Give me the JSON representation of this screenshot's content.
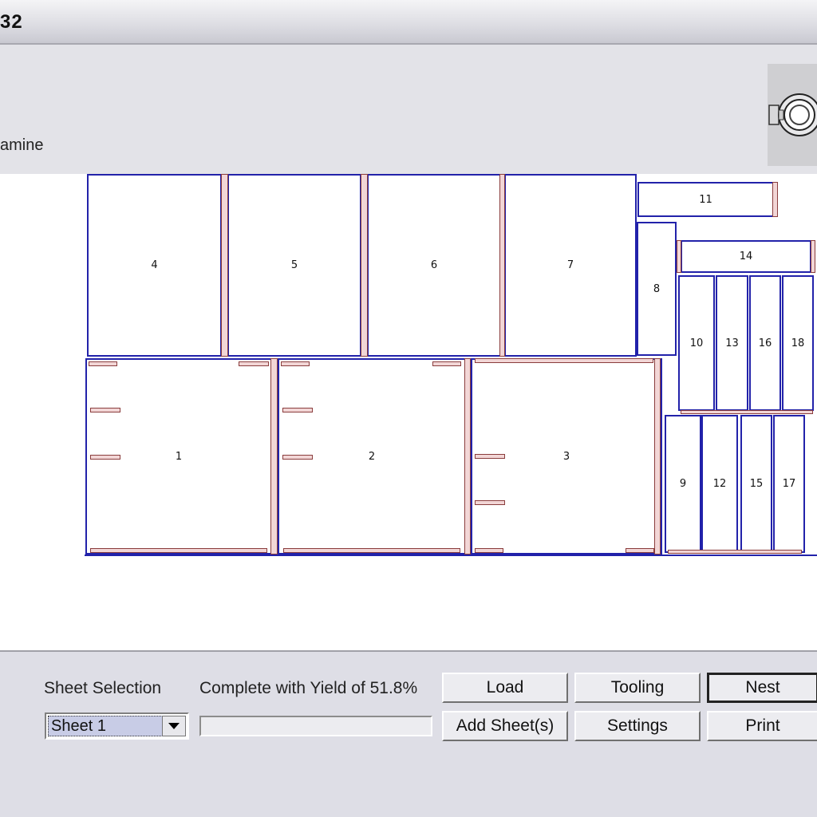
{
  "window": {
    "title_fragment": "32"
  },
  "header": {
    "material_label": "amine"
  },
  "parts": [
    "1",
    "2",
    "3",
    "4",
    "5",
    "6",
    "7",
    "8",
    "9",
    "10",
    "11",
    "12",
    "13",
    "14",
    "15",
    "16",
    "17",
    "18"
  ],
  "controls": {
    "sheet_selection_label": "Sheet Selection",
    "sheet_selected": "Sheet 1",
    "status_text": "Complete with Yield of 51.8%",
    "yield_percent": 51.8,
    "buttons": {
      "load": "Load",
      "tooling": "Tooling",
      "nest": "Nest",
      "add_sheets": "Add Sheet(s)",
      "settings": "Settings",
      "print": "Print"
    }
  },
  "icons": {
    "logo": "round-logo-icon",
    "dropdown": "chevron-down-icon"
  }
}
